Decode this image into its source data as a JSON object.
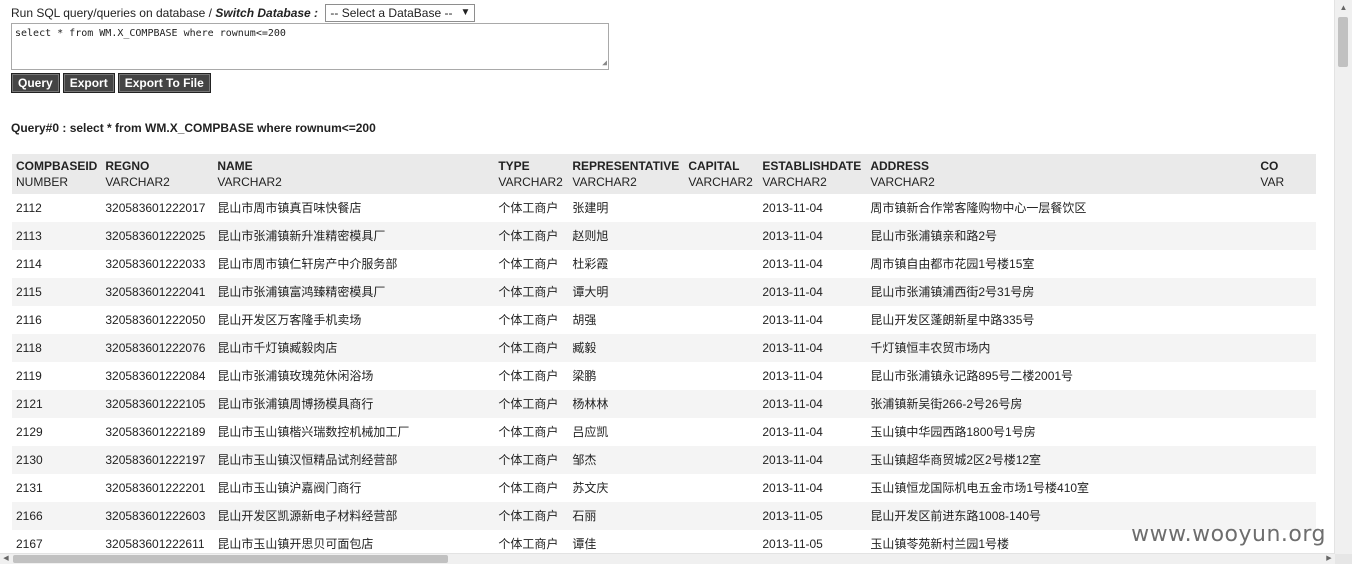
{
  "header": {
    "run_label": "Run SQL query/queries on database / ",
    "switch_label": "Switch Database :",
    "db_select_value": "-- Select a DataBase --"
  },
  "sql_input": {
    "value": "select * from WM.X_COMPBASE where rownum<=200"
  },
  "buttons": {
    "query": "Query",
    "export": "Export",
    "export_file": "Export To File"
  },
  "query_title": "Query#0 : select * from WM.X_COMPBASE where rownum<=200",
  "columns": [
    {
      "name": "COMPBASEID",
      "type": "NUMBER"
    },
    {
      "name": "REGNO",
      "type": "VARCHAR2"
    },
    {
      "name": "NAME",
      "type": "VARCHAR2"
    },
    {
      "name": "TYPE",
      "type": "VARCHAR2"
    },
    {
      "name": "REPRESENTATIVE",
      "type": "VARCHAR2"
    },
    {
      "name": "CAPITAL",
      "type": "VARCHAR2"
    },
    {
      "name": "ESTABLISHDATE",
      "type": "VARCHAR2"
    },
    {
      "name": "ADDRESS",
      "type": "VARCHAR2"
    },
    {
      "name": "CO",
      "type": "VAR"
    }
  ],
  "rows": [
    [
      "2112",
      "320583601222017",
      "昆山市周市镇真百味快餐店",
      "个体工商户",
      "张建明",
      "",
      "2013-11-04",
      "周市镇新合作常客隆购物中心一层餐饮区",
      ""
    ],
    [
      "2113",
      "320583601222025",
      "昆山市张浦镇新升准精密模具厂",
      "个体工商户",
      "赵则旭",
      "",
      "2013-11-04",
      "昆山市张浦镇亲和路2号",
      ""
    ],
    [
      "2114",
      "320583601222033",
      "昆山市周市镇仁轩房产中介服务部",
      "个体工商户",
      "杜彩霞",
      "",
      "2013-11-04",
      "周市镇自由都市花园1号楼15室",
      ""
    ],
    [
      "2115",
      "320583601222041",
      "昆山市张浦镇富鸿臻精密模具厂",
      "个体工商户",
      "谭大明",
      "",
      "2013-11-04",
      "昆山市张浦镇浦西街2号31号房",
      ""
    ],
    [
      "2116",
      "320583601222050",
      "昆山开发区万客隆手机卖场",
      "个体工商户",
      "胡强",
      "",
      "2013-11-04",
      "昆山开发区蓬朗新星中路335号",
      ""
    ],
    [
      "2118",
      "320583601222076",
      "昆山市千灯镇臧毅肉店",
      "个体工商户",
      "臧毅",
      "",
      "2013-11-04",
      "千灯镇恒丰农贸市场内",
      ""
    ],
    [
      "2119",
      "320583601222084",
      "昆山市张浦镇玫瑰苑休闲浴场",
      "个体工商户",
      "梁鹏",
      "",
      "2013-11-04",
      "昆山市张浦镇永记路895号二楼2001号",
      ""
    ],
    [
      "2121",
      "320583601222105",
      "昆山市张浦镇周博扬模具商行",
      "个体工商户",
      "杨林林",
      "",
      "2013-11-04",
      "张浦镇新吴街266-2号26号房",
      ""
    ],
    [
      "2129",
      "320583601222189",
      "昆山市玉山镇楷兴瑞数控机械加工厂",
      "个体工商户",
      "吕应凯",
      "",
      "2013-11-04",
      "玉山镇中华园西路1800号1号房",
      ""
    ],
    [
      "2130",
      "320583601222197",
      "昆山市玉山镇汉恒精品试剂经营部",
      "个体工商户",
      "邹杰",
      "",
      "2013-11-04",
      "玉山镇超华商贸城2区2号楼12室",
      ""
    ],
    [
      "2131",
      "320583601222201",
      "昆山市玉山镇沪嘉阀门商行",
      "个体工商户",
      "苏文庆",
      "",
      "2013-11-04",
      "玉山镇恒龙国际机电五金市场1号楼410室",
      ""
    ],
    [
      "2166",
      "320583601222603",
      "昆山开发区凯源新电子材料经营部",
      "个体工商户",
      "石丽",
      "",
      "2013-11-05",
      "昆山开发区前进东路1008-140号",
      ""
    ],
    [
      "2167",
      "320583601222611",
      "昆山市玉山镇开思贝可面包店",
      "个体工商户",
      "谭佳",
      "",
      "2013-11-05",
      "玉山镇苓苑新村兰园1号楼",
      ""
    ]
  ],
  "watermark": "www.wooyun.org",
  "icons": {
    "dropdown": "chevron-down-icon",
    "resize": "resize-grip-icon"
  }
}
